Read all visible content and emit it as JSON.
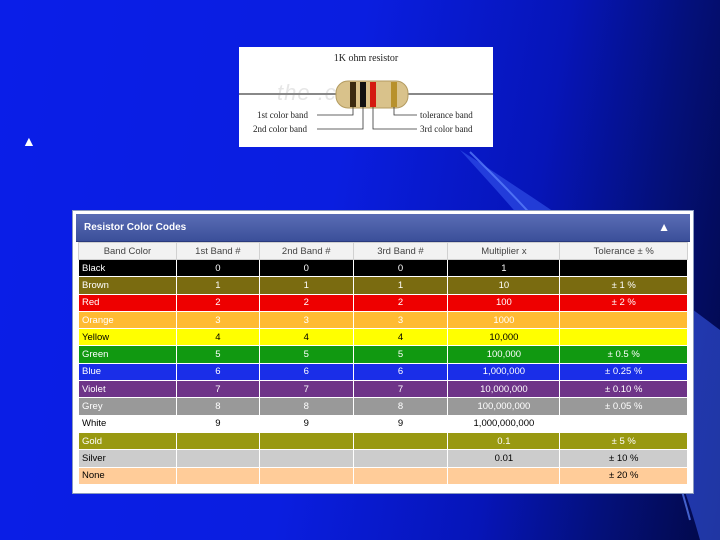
{
  "slide": {
    "bullet": "▲"
  },
  "resistor_figure": {
    "title": "1K ohm resistor",
    "watermark": "the      .com",
    "label_1st": "1st color band",
    "label_2nd": "2nd color band",
    "label_tol": "tolerance band",
    "label_3rd": "3rd color band",
    "bands": [
      "#3b2a10",
      "#111111",
      "#d41a10",
      "#b8912c"
    ]
  },
  "table_panel": {
    "title": "Resistor Color Codes",
    "collapse_icon": "▲",
    "headers": [
      "Band Color",
      "1st Band #",
      "2nd Band #",
      "3rd Band #",
      "Multiplier x",
      "Tolerance ± %"
    ],
    "rows": [
      {
        "name": "Black",
        "b1": "0",
        "b2": "0",
        "b3": "0",
        "mult": "1",
        "tol": "",
        "bg": "#000000",
        "fg": "white"
      },
      {
        "name": "Brown",
        "b1": "1",
        "b2": "1",
        "b3": "1",
        "mult": "10",
        "tol": "± 1 %",
        "bg": "#7a6b10",
        "fg": "white"
      },
      {
        "name": "Red",
        "b1": "2",
        "b2": "2",
        "b3": "2",
        "mult": "100",
        "tol": "± 2 %",
        "bg": "#ee0000",
        "fg": "white"
      },
      {
        "name": "Orange",
        "b1": "3",
        "b2": "3",
        "b3": "3",
        "mult": "1000",
        "tol": "",
        "bg": "#ffbb33",
        "fg": "white"
      },
      {
        "name": "Yellow",
        "b1": "4",
        "b2": "4",
        "b3": "4",
        "mult": "10,000",
        "tol": "",
        "bg": "#ffff00",
        "fg": "black"
      },
      {
        "name": "Green",
        "b1": "5",
        "b2": "5",
        "b3": "5",
        "mult": "100,000",
        "tol": "± 0.5 %",
        "bg": "#119911",
        "fg": "white"
      },
      {
        "name": "Blue",
        "b1": "6",
        "b2": "6",
        "b3": "6",
        "mult": "1,000,000",
        "tol": "± 0.25 %",
        "bg": "#1a2ee8",
        "fg": "white"
      },
      {
        "name": "Violet",
        "b1": "7",
        "b2": "7",
        "b3": "7",
        "mult": "10,000,000",
        "tol": "± 0.10 %",
        "bg": "#6e3488",
        "fg": "white"
      },
      {
        "name": "Grey",
        "b1": "8",
        "b2": "8",
        "b3": "8",
        "mult": "100,000,000",
        "tol": "± 0.05 %",
        "bg": "#999999",
        "fg": "white"
      },
      {
        "name": "White",
        "b1": "9",
        "b2": "9",
        "b3": "9",
        "mult": "1,000,000,000",
        "tol": "",
        "bg": "#ffffff",
        "fg": "black"
      },
      {
        "name": "Gold",
        "b1": "",
        "b2": "",
        "b3": "",
        "mult": "0.1",
        "tol": "± 5 %",
        "bg": "#999911",
        "fg": "white"
      },
      {
        "name": "Silver",
        "b1": "",
        "b2": "",
        "b3": "",
        "mult": "0.01",
        "tol": "± 10 %",
        "bg": "#cccccc",
        "fg": "black"
      },
      {
        "name": "None",
        "b1": "",
        "b2": "",
        "b3": "",
        "mult": "",
        "tol": "± 20 %",
        "bg": "#ffcc99",
        "fg": "black"
      }
    ]
  }
}
